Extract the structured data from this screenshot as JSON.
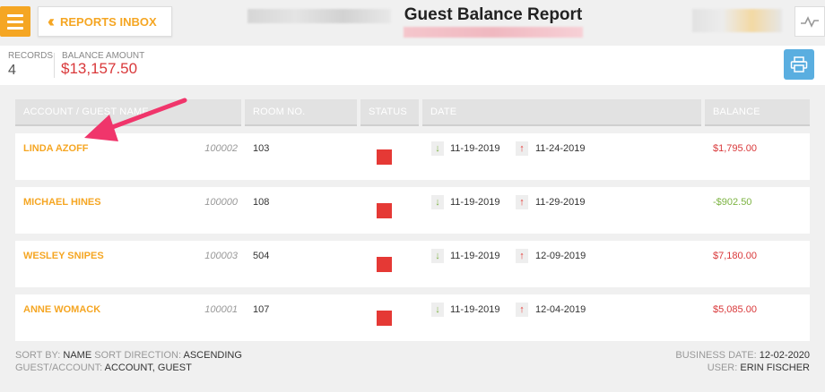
{
  "header": {
    "back_label": "REPORTS INBOX",
    "title": "Guest Balance Report"
  },
  "summary": {
    "records_label": "RECORDS",
    "records_value": "4",
    "balance_label": "BALANCE AMOUNT",
    "balance_value": "$13,157.50"
  },
  "columns": [
    "ACCOUNT / GUEST NAME",
    "ROOM NO.",
    "STATUS",
    "DATE",
    "BALANCE"
  ],
  "rows": [
    {
      "guest": "LINDA AZOFF",
      "account": "100002",
      "room": "103",
      "date_in": "11-19-2019",
      "date_out": "11-24-2019",
      "balance": "$1,795.00",
      "balance_color": "#d9383a"
    },
    {
      "guest": "MICHAEL HINES",
      "account": "100000",
      "room": "108",
      "date_in": "11-19-2019",
      "date_out": "11-29-2019",
      "balance": "-$902.50",
      "balance_color": "#7cb342"
    },
    {
      "guest": "WESLEY SNIPES",
      "account": "100003",
      "room": "504",
      "date_in": "11-19-2019",
      "date_out": "12-09-2019",
      "balance": "$7,180.00",
      "balance_color": "#d9383a"
    },
    {
      "guest": "ANNE WOMACK",
      "account": "100001",
      "room": "107",
      "date_in": "11-19-2019",
      "date_out": "12-04-2019",
      "balance": "$5,085.00",
      "balance_color": "#d9383a"
    }
  ],
  "footer": {
    "sort_by_label": "SORT BY:",
    "sort_by_value": "NAME",
    "sort_dir_label": "SORT DIRECTION:",
    "sort_dir_value": "ASCENDING",
    "guest_account_label": "GUEST/ACCOUNT:",
    "guest_account_value": "ACCOUNT, GUEST",
    "business_date_label": "BUSINESS DATE:",
    "business_date_value": "12-02-2020",
    "user_label": "USER:",
    "user_value": "ERIN FISCHER"
  },
  "colors": {
    "accent": "#f5a623",
    "negative": "#d9383a",
    "positive": "#7cb342",
    "status_red": "#e53935",
    "print_blue": "#5aaee0",
    "annotation": "#f0356b"
  },
  "icons": [
    "menu-icon",
    "double-chevron-left-icon",
    "line-chart-icon",
    "print-icon",
    "arrow-down-icon",
    "arrow-up-icon"
  ]
}
